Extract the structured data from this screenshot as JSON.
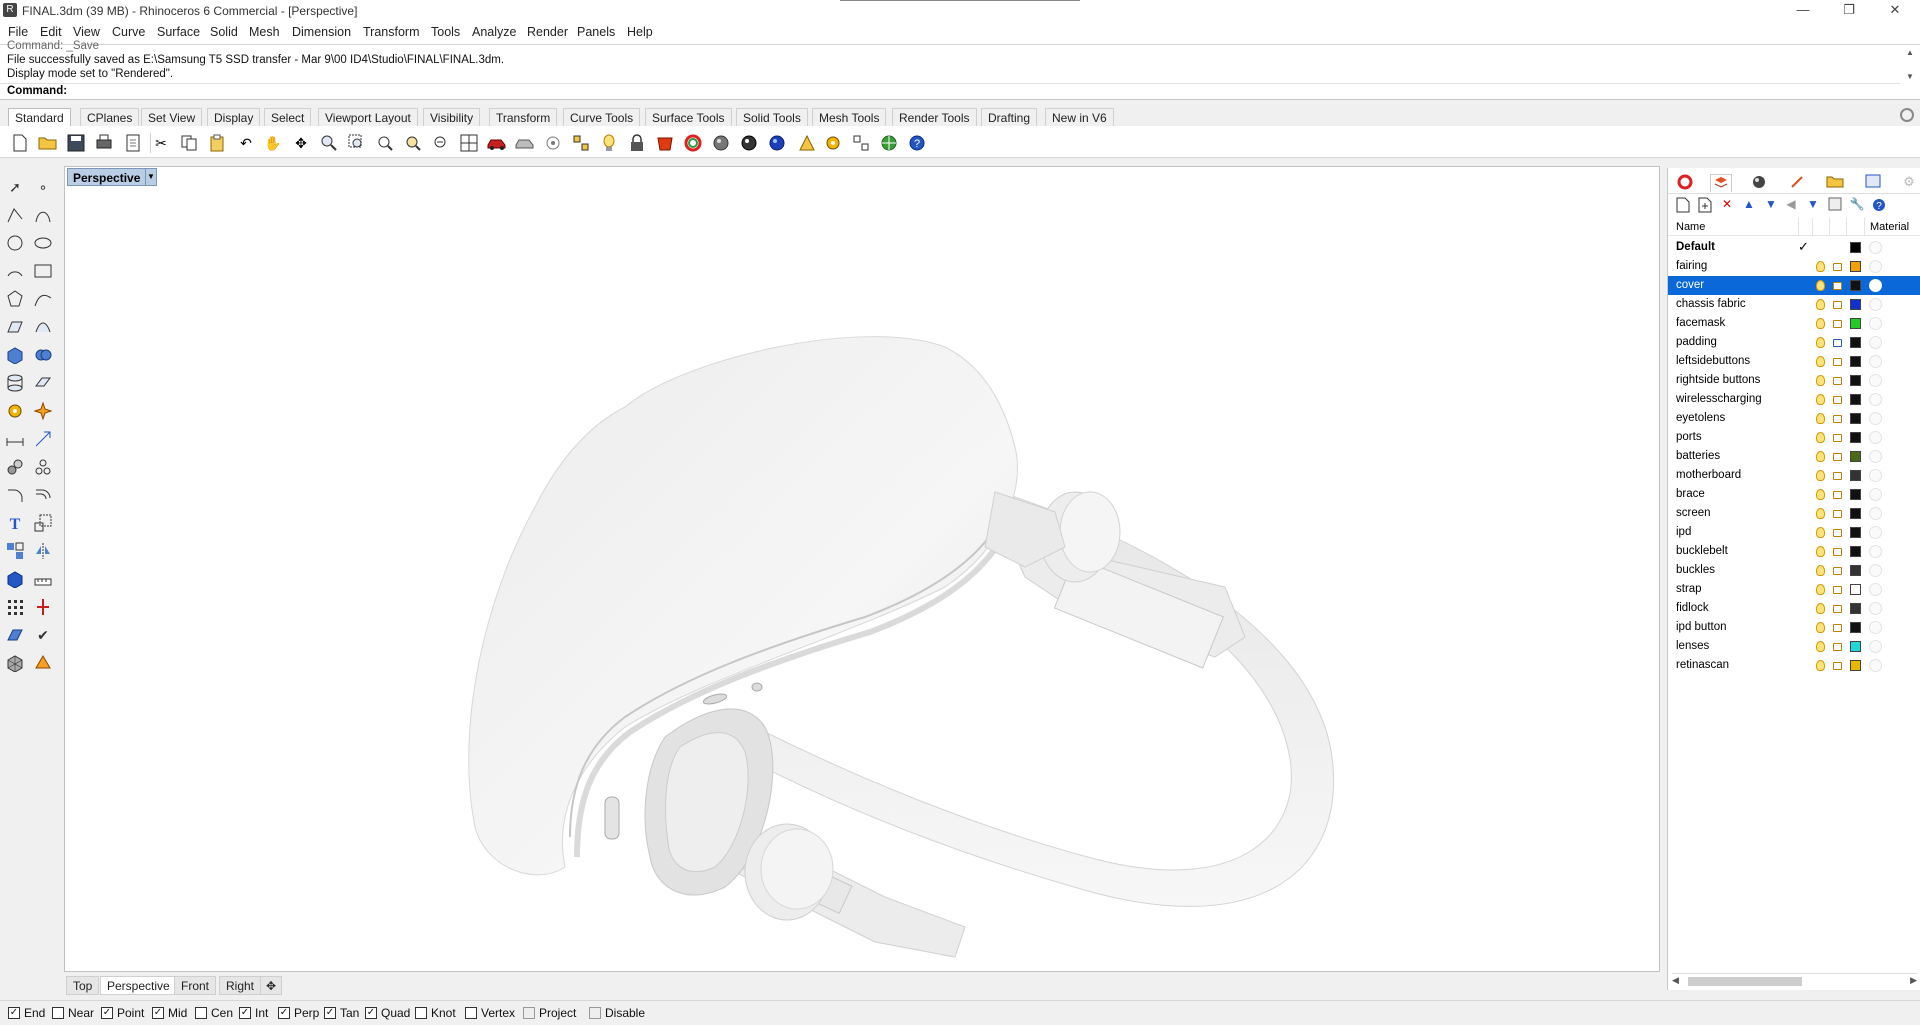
{
  "window": {
    "title": "FINAL.3dm (39 MB) - Rhinoceros 6 Commercial - [Perspective]",
    "controls": [
      "—",
      "❐",
      "✕"
    ]
  },
  "menu": [
    "File",
    "Edit",
    "View",
    "Curve",
    "Surface",
    "Solid",
    "Mesh",
    "Dimension",
    "Transform",
    "Tools",
    "Analyze",
    "Render",
    "Panels",
    "Help"
  ],
  "command": {
    "history": [
      "Command: _Save",
      "File successfully saved as E:\\Samsung T5 SSD transfer - Mar 9\\00 ID4\\Studio\\FINAL\\FINAL.3dm.",
      "Display mode set to \"Rendered\"."
    ],
    "prompt": "Command:"
  },
  "toolbar_tabs": [
    "Standard",
    "CPlanes",
    "Set View",
    "Display",
    "Select",
    "Viewport Layout",
    "Visibility",
    "Transform",
    "Curve Tools",
    "Surface Tools",
    "Solid Tools",
    "Mesh Tools",
    "Render Tools",
    "Drafting",
    "New in V6"
  ],
  "active_toolbar_tab": "Standard",
  "toolbar_icons": [
    "new-icon",
    "open-icon",
    "save-icon",
    "print-icon",
    "import-icon",
    "cut-icon",
    "copy-icon",
    "paste-icon",
    "undo-icon",
    "pan-icon",
    "rotate-view-icon",
    "zoom-icon",
    "zoom-window-icon",
    "zoom-extents-icon",
    "zoom-selected-icon",
    "zoom-previous-icon",
    "four-views-icon",
    "car-icon",
    "snapshot-icon",
    "gumball-icon",
    "osnap-icon",
    "light-icon",
    "lock-icon",
    "material-icon",
    "color-wheel-icon",
    "shaded-sphere-icon",
    "rendered-sphere-icon",
    "environment-sphere-icon",
    "render-icon",
    "settings-icon",
    "options-icon",
    "globe-icon",
    "help-icon"
  ],
  "viewport": {
    "label": "Perspective",
    "tabs": [
      "Top",
      "Perspective",
      "Front",
      "Right"
    ],
    "active_tab": "Perspective"
  },
  "osnaps": [
    {
      "label": "End",
      "checked": true
    },
    {
      "label": "Near",
      "checked": false
    },
    {
      "label": "Point",
      "checked": true
    },
    {
      "label": "Mid",
      "checked": true
    },
    {
      "label": "Cen",
      "checked": false
    },
    {
      "label": "Int",
      "checked": true
    },
    {
      "label": "Perp",
      "checked": true
    },
    {
      "label": "Tan",
      "checked": true
    },
    {
      "label": "Quad",
      "checked": true
    },
    {
      "label": "Knot",
      "checked": false
    },
    {
      "label": "Vertex",
      "checked": false
    },
    {
      "label": "Project",
      "checked": false
    },
    {
      "label": "Disable",
      "checked": false
    }
  ],
  "layers": {
    "header_name": "Name",
    "header_material": "Material",
    "items": [
      {
        "name": "Default",
        "color": "#000000",
        "current": true
      },
      {
        "name": "fairing",
        "color": "#f0a000"
      },
      {
        "name": "cover",
        "color": "#111111",
        "selected": true
      },
      {
        "name": "chassis fabric",
        "color": "#1030d0"
      },
      {
        "name": "facemask",
        "color": "#22cc22"
      },
      {
        "name": "padding",
        "color": "#111111",
        "locked": true
      },
      {
        "name": "leftsidebuttons",
        "color": "#111111"
      },
      {
        "name": "rightside buttons",
        "color": "#111111"
      },
      {
        "name": "wirelesscharging",
        "color": "#111111"
      },
      {
        "name": "eyetolens",
        "color": "#111111"
      },
      {
        "name": "ports",
        "color": "#111111"
      },
      {
        "name": "batteries",
        "color": "#4a6a18"
      },
      {
        "name": "motherboard",
        "color": "#333333"
      },
      {
        "name": "brace",
        "color": "#111111"
      },
      {
        "name": "screen",
        "color": "#111111"
      },
      {
        "name": "ipd",
        "color": "#111111"
      },
      {
        "name": "bucklebelt",
        "color": "#111111"
      },
      {
        "name": "buckles",
        "color": "#333333"
      },
      {
        "name": "strap",
        "color": "#ffffff"
      },
      {
        "name": "fidlock",
        "color": "#333333"
      },
      {
        "name": "ipd button",
        "color": "#111111"
      },
      {
        "name": "lenses",
        "color": "#20d8d8"
      },
      {
        "name": "retinascan",
        "color": "#e8b800"
      }
    ]
  },
  "colors": {
    "selection": "#0a68d8",
    "viewport_label_bg": "#b9cde5",
    "model_white": "#f2f2f2"
  }
}
